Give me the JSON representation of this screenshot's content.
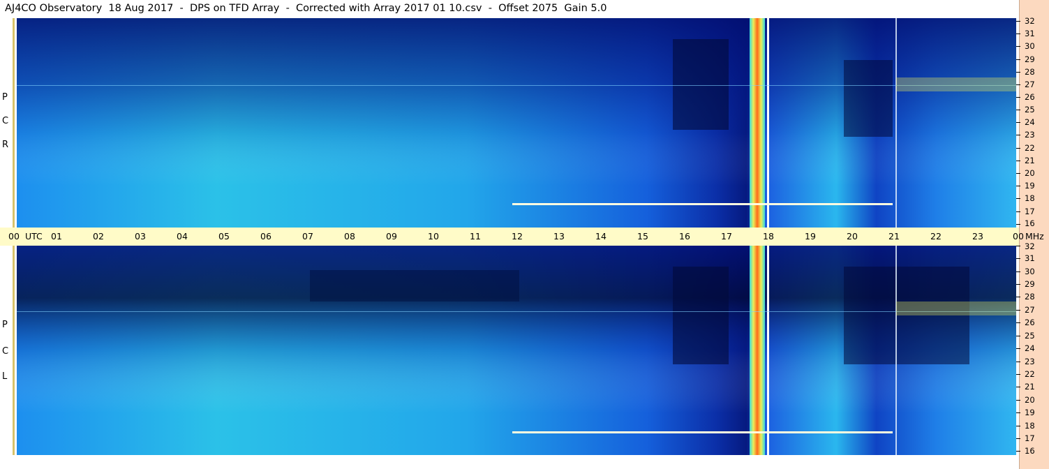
{
  "title": "AJ4CO Observatory  18 Aug 2017  -  DPS on TFD Array  -  Corrected with Array 2017 01 10.csv  -  Offset 2075  Gain 5.0",
  "panels": [
    {
      "id": "rcp",
      "polarization_letters": [
        "R",
        "C",
        "P"
      ]
    },
    {
      "id": "lcp",
      "polarization_letters": [
        "L",
        "C",
        "P"
      ]
    }
  ],
  "freq_ticks_mhz": [
    "32",
    "31",
    "30",
    "29",
    "28",
    "27",
    "26",
    "25",
    "24",
    "23",
    "22",
    "21",
    "20",
    "19",
    "18",
    "17",
    "16"
  ],
  "time_axis": {
    "labels": [
      "00",
      "UTC",
      "01",
      "02",
      "03",
      "04",
      "05",
      "06",
      "07",
      "08",
      "09",
      "10",
      "11",
      "12",
      "13",
      "14",
      "15",
      "16",
      "17",
      "18",
      "19",
      "20",
      "21",
      "22",
      "23",
      "00",
      "MHz"
    ]
  },
  "colors": {
    "low": "#02137a",
    "mid": "#1a6ee8",
    "high": "#29c6e6",
    "hot": "#f5ef57",
    "peak": "#ff5a1a",
    "time_axis_bg": "#fffbc8",
    "freq_axis_bg": "#fcd9bf"
  }
}
